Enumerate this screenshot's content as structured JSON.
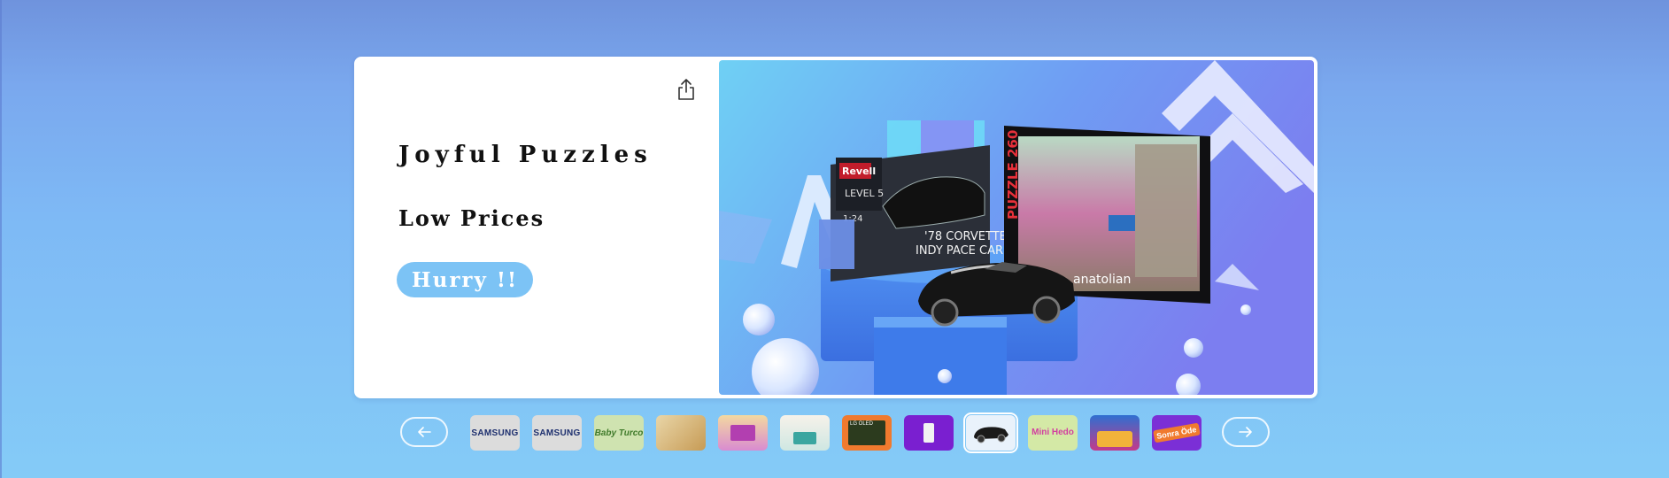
{
  "hero": {
    "title": "Joyful Puzzles",
    "subtitle": "Low Prices",
    "cta_label": "Hurry !!",
    "share_icon": "share-icon"
  },
  "banner_image": {
    "alt": "Revell '78 Corvette Indy Pace Car model kit and Anatolian 260 piece puzzle",
    "kit_brand": "Revell",
    "kit_level": "LEVEL 5",
    "kit_scale": "1:24",
    "kit_caption_line1": "'78 CORVETTE",
    "kit_caption_line2": "INDY PACE CAR",
    "puzzle_count": "PUZZLE 260",
    "puzzle_brand": "anatolian"
  },
  "carousel": {
    "prev_icon": "arrow-left-icon",
    "next_icon": "arrow-right-icon",
    "active_index": 8,
    "thumbnails": [
      {
        "label": "SAMSUNG",
        "kind": "brand-samsung"
      },
      {
        "label": "SAMSUNG",
        "kind": "brand-samsung"
      },
      {
        "label": "Baby Turco",
        "kind": "brand-baby-turco"
      },
      {
        "label": "",
        "kind": "bedding"
      },
      {
        "label": "",
        "kind": "house-toy"
      },
      {
        "label": "",
        "kind": "living-room"
      },
      {
        "label": "LG OLED",
        "kind": "lg-tv"
      },
      {
        "label": "",
        "kind": "purple-product"
      },
      {
        "label": "",
        "kind": "corvette-puzzle"
      },
      {
        "label": "Mini Hedo",
        "kind": "mini-hedo"
      },
      {
        "label": "",
        "kind": "family-game"
      },
      {
        "label": "Sonra Öde",
        "kind": "pay-later"
      }
    ]
  },
  "colors": {
    "cta": "#7cc3f5",
    "page_top": "#6f93dd",
    "page_bottom": "#84cbf7"
  }
}
